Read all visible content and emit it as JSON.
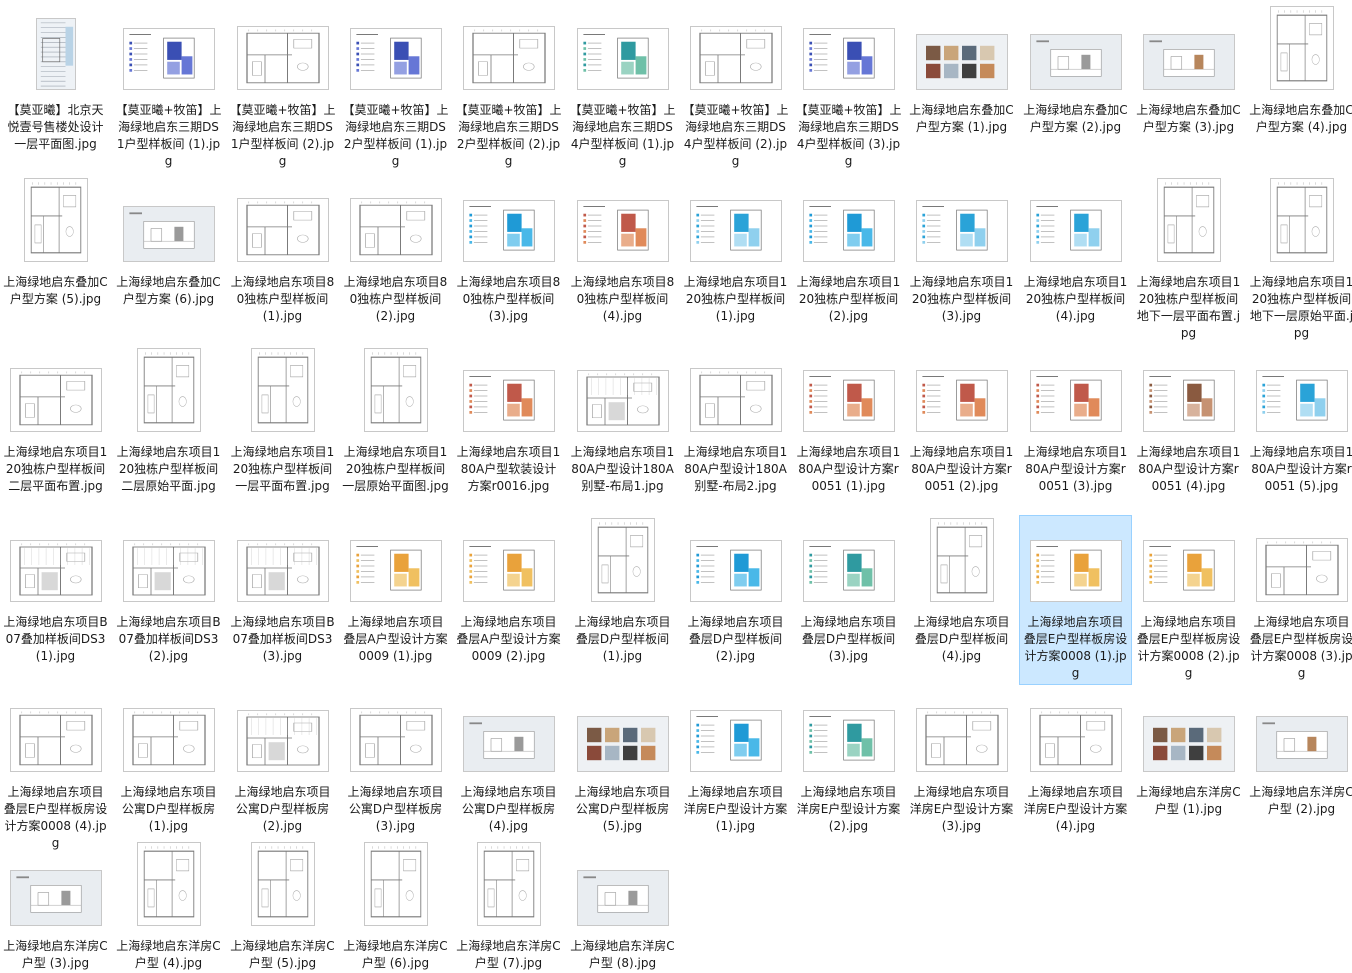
{
  "files": [
    {
      "name": "【莫亚曦】北京天悦壹号售楼处设计一层平面图.jpg",
      "thumb": "tall"
    },
    {
      "name": "【莫亚曦+牧笛】上海绿地启东三期DS1户型样板间 (1).jpg",
      "thumb": "sheet-blue"
    },
    {
      "name": "【莫亚曦+牧笛】上海绿地启东三期DS1户型样板间 (2).jpg",
      "thumb": "plan"
    },
    {
      "name": "【莫亚曦+牧笛】上海绿地启东三期DS2户型样板间 (1).jpg",
      "thumb": "sheet-blue"
    },
    {
      "name": "【莫亚曦+牧笛】上海绿地启东三期DS2户型样板间 (2).jpg",
      "thumb": "plan"
    },
    {
      "name": "【莫亚曦+牧笛】上海绿地启东三期DS4户型样板间 (1).jpg",
      "thumb": "sheet-teal"
    },
    {
      "name": "【莫亚曦+牧笛】上海绿地启东三期DS4户型样板间 (2).jpg",
      "thumb": "plan"
    },
    {
      "name": "【莫亚曦+牧笛】上海绿地启东三期DS4户型样板间 (3).jpg",
      "thumb": "sheet-blue"
    },
    {
      "name": "上海绿地启东叠加C户型方案 (1).jpg",
      "thumb": "mood"
    },
    {
      "name": "上海绿地启东叠加C户型方案 (2).jpg",
      "thumb": "elev"
    },
    {
      "name": "上海绿地启东叠加C户型方案 (3).jpg",
      "thumb": "elev-warm"
    },
    {
      "name": "上海绿地启东叠加C户型方案 (4).jpg",
      "thumb": "plan-tall"
    },
    {
      "name": "上海绿地启东叠加C户型方案 (5).jpg",
      "thumb": "plan-tall"
    },
    {
      "name": "上海绿地启东叠加C户型方案 (6).jpg",
      "thumb": "elev"
    },
    {
      "name": "上海绿地启东项目80独栋户型样板间 (1).jpg",
      "thumb": "plan"
    },
    {
      "name": "上海绿地启东项目80独栋户型样板间 (2).jpg",
      "thumb": "plan"
    },
    {
      "name": "上海绿地启东项目80独栋户型样板间 (3).jpg",
      "thumb": "sheet-cyan2"
    },
    {
      "name": "上海绿地启东项目80独栋户型样板间 (4).jpg",
      "thumb": "sheet-red"
    },
    {
      "name": "上海绿地启东项目120独栋户型样板间 (1).jpg",
      "thumb": "sheet-cyan"
    },
    {
      "name": "上海绿地启东项目120独栋户型样板间 (2).jpg",
      "thumb": "sheet-cyan2"
    },
    {
      "name": "上海绿地启东项目120独栋户型样板间 (3).jpg",
      "thumb": "sheet-cyan"
    },
    {
      "name": "上海绿地启东项目120独栋户型样板间 (4).jpg",
      "thumb": "sheet-cyan"
    },
    {
      "name": "上海绿地启东项目120独栋户型样板间地下一层平面布置.jpg",
      "thumb": "plan-tall"
    },
    {
      "name": "上海绿地启东项目120独栋户型样板间地下一层原始平面.jpg",
      "thumb": "plan-tall"
    },
    {
      "name": "上海绿地启东项目120独栋户型样板间二层平面布置.jpg",
      "thumb": "plan"
    },
    {
      "name": "上海绿地启东项目120独栋户型样板间二层原始平面.jpg",
      "thumb": "plan-tall"
    },
    {
      "name": "上海绿地启东项目120独栋户型样板间一层平面布置.jpg",
      "thumb": "plan-tall"
    },
    {
      "name": "上海绿地启东项目120独栋户型样板间一层原始平面图.jpg",
      "thumb": "plan-tall"
    },
    {
      "name": "上海绿地启东项目180A户型软装设计方案r0016.jpg",
      "thumb": "sheet-red"
    },
    {
      "name": "上海绿地启东项目180A户型设计180A别墅-布局1.jpg",
      "thumb": "plan-dense"
    },
    {
      "name": "上海绿地启东项目180A户型设计180A别墅-布局2.jpg",
      "thumb": "plan"
    },
    {
      "name": "上海绿地启东项目180A户型设计方案r0051 (1).jpg",
      "thumb": "sheet-red"
    },
    {
      "name": "上海绿地启东项目180A户型设计方案r0051 (2).jpg",
      "thumb": "sheet-red"
    },
    {
      "name": "上海绿地启东项目180A户型设计方案r0051 (3).jpg",
      "thumb": "sheet-red"
    },
    {
      "name": "上海绿地启东项目180A户型设计方案r0051 (4).jpg",
      "thumb": "sheet-brown"
    },
    {
      "name": "上海绿地启东项目180A户型设计方案r0051 (5).jpg",
      "thumb": "sheet-cyan"
    },
    {
      "name": "上海绿地启东项目B07叠加样板间DS3 (1).jpg",
      "thumb": "plan-dense"
    },
    {
      "name": "上海绿地启东项目B07叠加样板间DS3 (2).jpg",
      "thumb": "plan-dense"
    },
    {
      "name": "上海绿地启东项目B07叠加样板间DS3 (3).jpg",
      "thumb": "plan-dense"
    },
    {
      "name": "上海绿地启东项目叠层A户型设计方案0009 (1).jpg",
      "thumb": "sheet-orange"
    },
    {
      "name": "上海绿地启东项目叠层A户型设计方案0009 (2).jpg",
      "thumb": "sheet-orange"
    },
    {
      "name": "上海绿地启东项目叠层D户型样板间 (1).jpg",
      "thumb": "plan-tall"
    },
    {
      "name": "上海绿地启东项目叠层D户型样板间 (2).jpg",
      "thumb": "sheet-cyan2"
    },
    {
      "name": "上海绿地启东项目叠层D户型样板间 (3).jpg",
      "thumb": "sheet-teal"
    },
    {
      "name": "上海绿地启东项目叠层D户型样板间 (4).jpg",
      "thumb": "plan-tall"
    },
    {
      "name": "上海绿地启东项目叠层E户型样板房设计方案0008 (1).jpg",
      "thumb": "sheet-orange",
      "selected": true
    },
    {
      "name": "上海绿地启东项目叠层E户型样板房设计方案0008 (2).jpg",
      "thumb": "sheet-orange"
    },
    {
      "name": "上海绿地启东项目叠层E户型样板房设计方案0008 (3).jpg",
      "thumb": "plan"
    },
    {
      "name": "上海绿地启东项目叠层E户型样板房设计方案0008 (4).jpg",
      "thumb": "plan"
    },
    {
      "name": "上海绿地启东项目公寓D户型样板房 (1).jpg",
      "thumb": "plan"
    },
    {
      "name": "上海绿地启东项目公寓D户型样板房 (2).jpg",
      "thumb": "plan-dense"
    },
    {
      "name": "上海绿地启东项目公寓D户型样板房 (3).jpg",
      "thumb": "plan"
    },
    {
      "name": "上海绿地启东项目公寓D户型样板房 (4).jpg",
      "thumb": "elev"
    },
    {
      "name": "上海绿地启东项目公寓D户型样板房 (5).jpg",
      "thumb": "mood"
    },
    {
      "name": "上海绿地启东项目洋房E户型设计方案 (1).jpg",
      "thumb": "sheet-cyan2"
    },
    {
      "name": "上海绿地启东项目洋房E户型设计方案 (2).jpg",
      "thumb": "sheet-teal"
    },
    {
      "name": "上海绿地启东项目洋房E户型设计方案 (3).jpg",
      "thumb": "plan"
    },
    {
      "name": "上海绿地启东项目洋房E户型设计方案 (4).jpg",
      "thumb": "plan"
    },
    {
      "name": "上海绿地启东洋房C户型 (1).jpg",
      "thumb": "mood"
    },
    {
      "name": "上海绿地启东洋房C户型 (2).jpg",
      "thumb": "elev-warm"
    },
    {
      "name": "上海绿地启东洋房C户型 (3).jpg",
      "thumb": "elev"
    },
    {
      "name": "上海绿地启东洋房C户型 (4).jpg",
      "thumb": "plan-tall"
    },
    {
      "name": "上海绿地启东洋房C户型 (5).jpg",
      "thumb": "plan-tall"
    },
    {
      "name": "上海绿地启东洋房C户型 (6).jpg",
      "thumb": "plan-tall"
    },
    {
      "name": "上海绿地启东洋房C户型 (7).jpg",
      "thumb": "plan-tall"
    },
    {
      "name": "上海绿地启东洋房C户型 (8).jpg",
      "thumb": "elev"
    }
  ],
  "colors": {
    "selection_bg": "#cce8ff",
    "selection_border": "#99d1ff",
    "text": "#1a1a1a"
  }
}
